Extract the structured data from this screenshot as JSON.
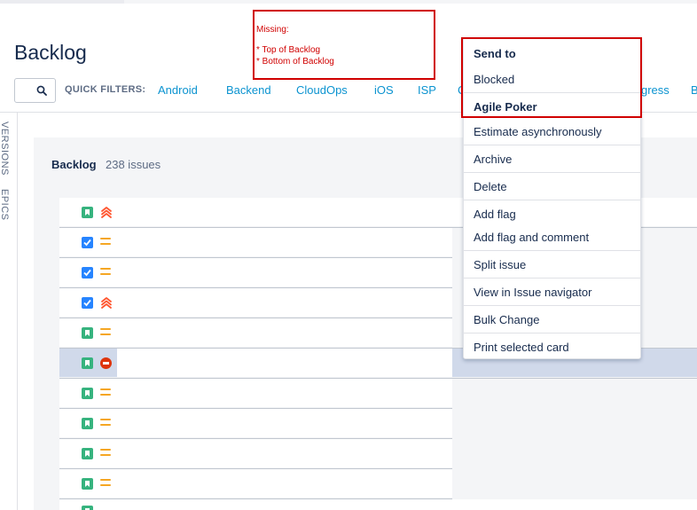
{
  "page": {
    "title": "Backlog"
  },
  "search": {
    "placeholder": ""
  },
  "quick_filters": {
    "label": "QUICK FILTERS:",
    "items": [
      "Android",
      "Backend",
      "CloudOps",
      "iOS",
      "ISP",
      "C",
      "gress",
      "B"
    ]
  },
  "side_tabs": {
    "versions": "VERSIONS",
    "epics": "EPICS"
  },
  "backlog": {
    "title": "Backlog",
    "count": "238 issues"
  },
  "rows": [
    {
      "type": "story",
      "priority": "highest"
    },
    {
      "type": "task",
      "priority": "medium"
    },
    {
      "type": "task",
      "priority": "medium"
    },
    {
      "type": "task",
      "priority": "highest"
    },
    {
      "type": "story",
      "priority": "medium"
    },
    {
      "type": "story",
      "priority": "blocker",
      "selected": true
    },
    {
      "type": "story",
      "priority": "medium"
    },
    {
      "type": "story",
      "priority": "medium"
    },
    {
      "type": "story",
      "priority": "medium"
    },
    {
      "type": "story",
      "priority": "medium"
    }
  ],
  "context_menu": {
    "send_to_header": "Send to",
    "blocked": "Blocked",
    "agile_poker_header": "Agile Poker",
    "estimate_async": "Estimate asynchronously",
    "archive": "Archive",
    "delete": "Delete",
    "add_flag": "Add flag",
    "add_flag_comment": "Add flag and comment",
    "split_issue": "Split issue",
    "view_in_navigator": "View in Issue navigator",
    "bulk_change": "Bulk Change",
    "print_card": "Print selected card"
  },
  "annotation": {
    "title": "Missing:",
    "line1": "* Top of Backlog",
    "line2": "* Bottom of Backlog",
    "color": "#d00000"
  },
  "colors": {
    "link": "#0b93d0",
    "story": "#36b37e",
    "task": "#2684ff",
    "priority_high": "#ff5630",
    "priority_medium": "#f5a623",
    "blocker": "#de350b",
    "selected_row": "#d0d9ea"
  }
}
